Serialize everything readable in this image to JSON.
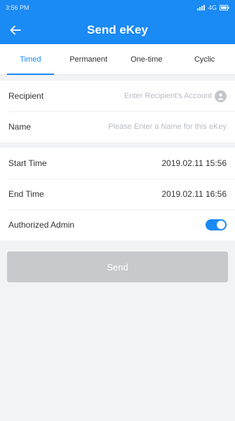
{
  "status_bar": {
    "time": "3:56 PM",
    "icons_text": "4G"
  },
  "header": {
    "title": "Send eKey",
    "back_icon": "arrow-left-icon"
  },
  "tabs": [
    {
      "label": "Timed",
      "active": true
    },
    {
      "label": "Permanent",
      "active": false
    },
    {
      "label": "One-time",
      "active": false
    },
    {
      "label": "Cyclic",
      "active": false
    }
  ],
  "form": {
    "recipient": {
      "label": "Recipient",
      "value": "",
      "placeholder": "Enter Recipient's Account",
      "icon": "contact-icon"
    },
    "name": {
      "label": "Name",
      "value": "",
      "placeholder": "Please Enter a Name for this eKey"
    }
  },
  "time": {
    "start_label": "Start Time",
    "start_value": "2019.02.11 15:56",
    "end_label": "End Time",
    "end_value": "2019.02.11 16:56"
  },
  "admin": {
    "label": "Authorized Admin",
    "enabled": true
  },
  "send_button": {
    "label": "Send",
    "enabled": false
  },
  "colors": {
    "primary": "#1a8af4",
    "background": "#f2f3f5",
    "disabled_button": "#c7c9cc"
  }
}
